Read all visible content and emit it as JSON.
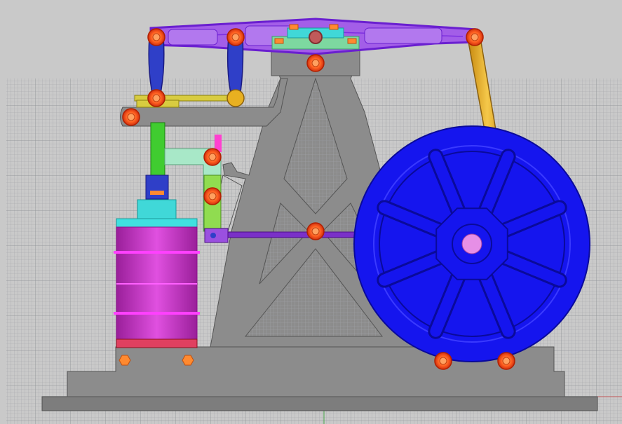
{
  "viewport": {
    "background": "#c9c9c9",
    "grid_color": "#9ea1a5",
    "grid_major_color": "#8a8d92",
    "axis_color": "#2aa02a",
    "x_axis_color": "#d04040"
  },
  "model": {
    "frame_color": "#8c8c8c",
    "frame_edge": "#555555",
    "base_color": "#7d7d7d",
    "beam_color": "#a35ee8",
    "beam_edge": "#6a1fd0",
    "link_color": "#2f3fc8",
    "flywheel_color": "#1515ee",
    "flywheel_edge": "#0a0a9a",
    "hub_color": "#e68fe6",
    "cylinder_color": "#cc33cc",
    "cylinder_band": "#e040e0",
    "head_color": "#40d8d8",
    "crossbar_color": "#d8cc40",
    "conn_rod_color": "#e8b020",
    "piston_rod_color": "#40cc30",
    "eccentric_rod_color": "#7a30c8",
    "valve_chest_color": "#a8e8c8",
    "joint_outer": "#ff5020",
    "joint_inner": "#ff8a40",
    "nut_color": "#ff8a30",
    "cam_color": "#40e0e0"
  }
}
